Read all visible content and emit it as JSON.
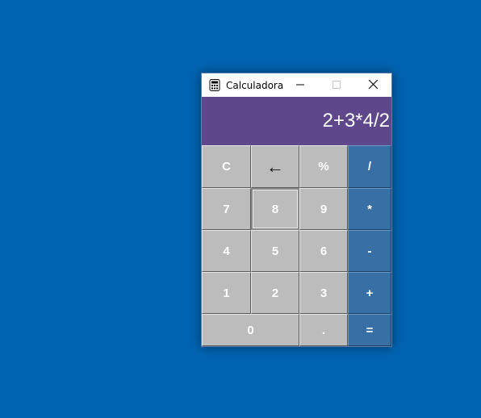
{
  "window": {
    "title": "Calculadora",
    "icon": "calculator-icon",
    "controls": {
      "minimize": "minimize-icon",
      "maximize": "maximize-icon",
      "close": "close-icon"
    }
  },
  "display": {
    "expression": "2+3*4/2",
    "background": "#5e478a"
  },
  "colors": {
    "desktop": "#0063b1",
    "key_gray": "#bcbcbc",
    "key_operator": "#386fa4"
  },
  "keypad": {
    "row1": [
      "C",
      "←",
      "%",
      "/"
    ],
    "row2": [
      "7",
      "8",
      "9",
      "*"
    ],
    "row3": [
      "4",
      "5",
      "6",
      "-"
    ],
    "row4": [
      "1",
      "2",
      "3",
      "+"
    ],
    "row5": [
      "0",
      ".",
      "="
    ]
  }
}
